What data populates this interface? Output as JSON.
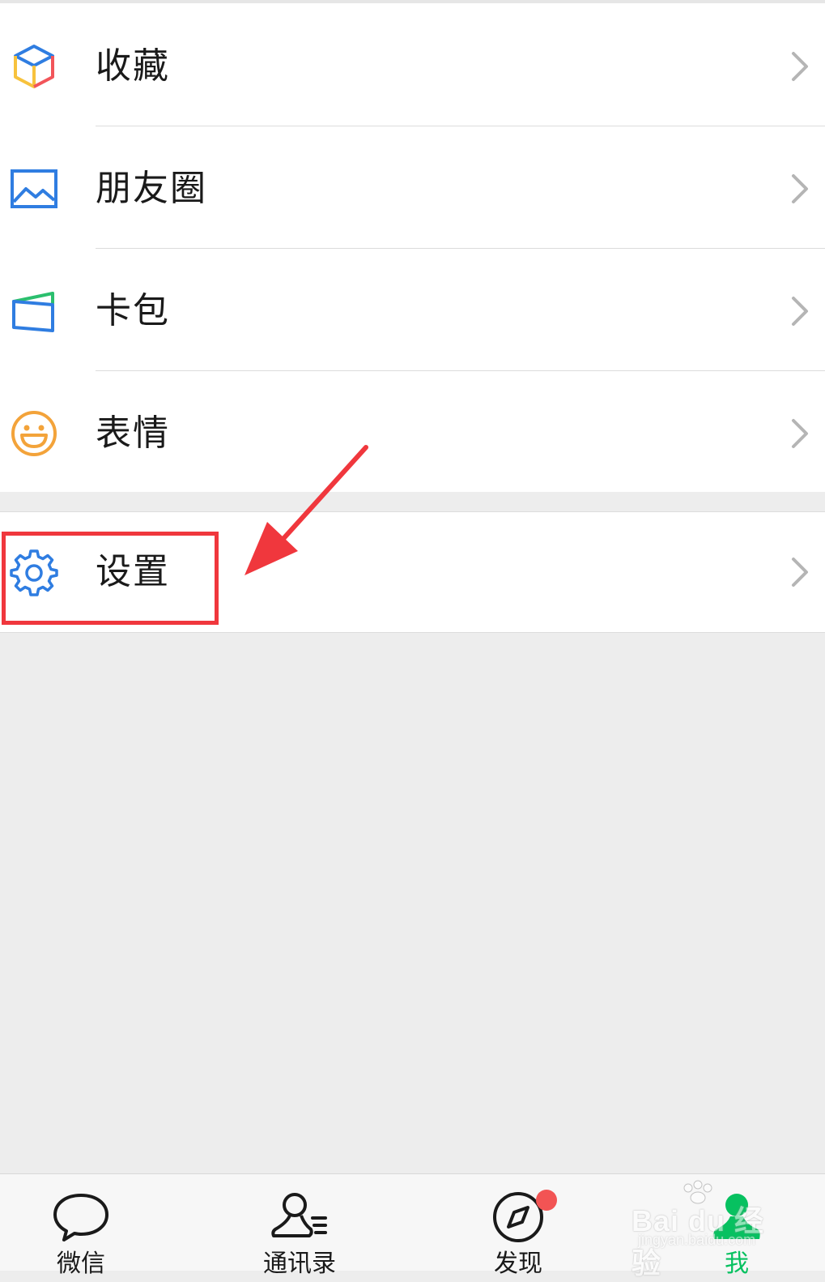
{
  "menu": {
    "items": [
      {
        "label": "收藏",
        "icon": "favorites-cube-icon"
      },
      {
        "label": "朋友圈",
        "icon": "moments-photo-icon"
      },
      {
        "label": "卡包",
        "icon": "card-wallet-icon"
      },
      {
        "label": "表情",
        "icon": "sticker-smiley-icon"
      }
    ],
    "settings": {
      "label": "设置",
      "icon": "gear-icon"
    }
  },
  "annotation": {
    "highlight_color": "#f0373d",
    "arrow_color": "#f0373d"
  },
  "tabbar": {
    "tabs": [
      {
        "label": "微信",
        "icon": "chat-bubble-icon",
        "active": false
      },
      {
        "label": "通讯录",
        "icon": "contacts-icon",
        "active": false
      },
      {
        "label": "发现",
        "icon": "compass-icon",
        "active": false,
        "badge": true
      },
      {
        "label": "我",
        "icon": "me-person-icon",
        "active": true
      }
    ]
  },
  "watermark": {
    "main": "Bai du 经验",
    "sub": "jingyan.baidu.com"
  },
  "colors": {
    "active_green": "#07c160",
    "icon_blue": "#2f7de1",
    "smiley_orange": "#f3a33a",
    "badge_red": "#f25454",
    "background_gray": "#ededed"
  }
}
